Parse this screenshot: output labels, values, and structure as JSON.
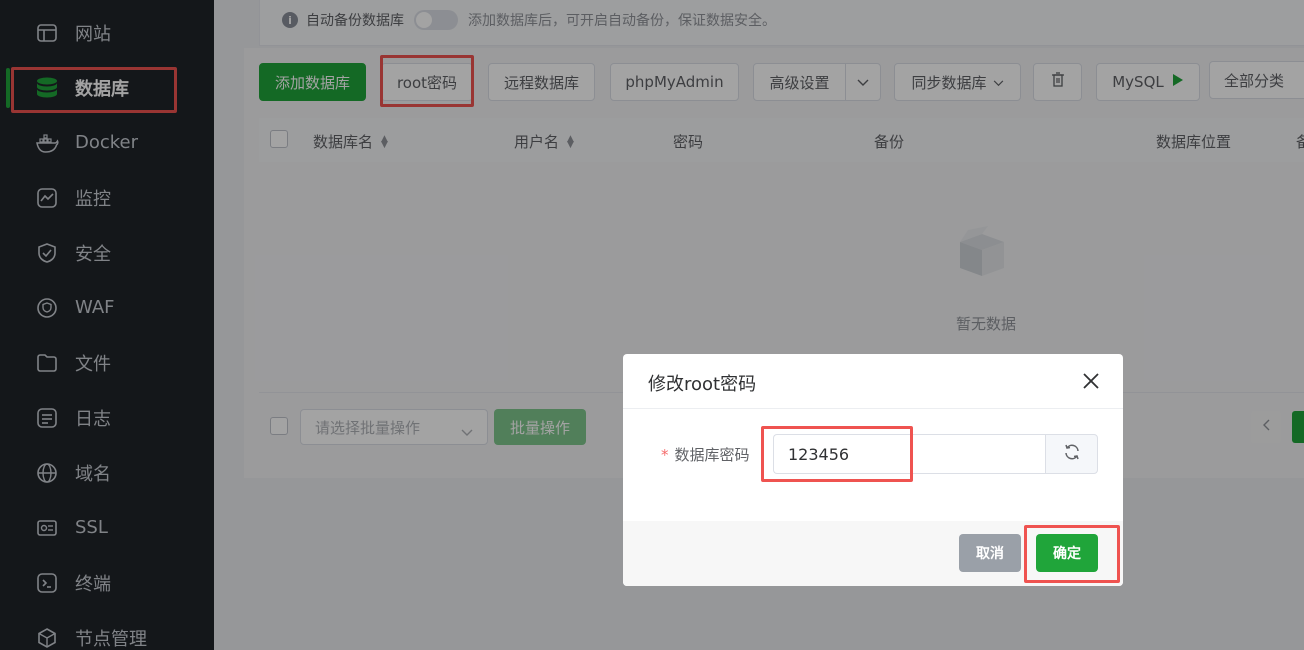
{
  "sidebar": {
    "items": [
      {
        "label": "网站",
        "icon": "website-icon"
      },
      {
        "label": "数据库",
        "icon": "database-icon",
        "active": true
      },
      {
        "label": "Docker",
        "icon": "docker-icon"
      },
      {
        "label": "监控",
        "icon": "monitor-icon"
      },
      {
        "label": "安全",
        "icon": "shield-icon"
      },
      {
        "label": "WAF",
        "icon": "waf-icon"
      },
      {
        "label": "文件",
        "icon": "folder-icon"
      },
      {
        "label": "日志",
        "icon": "log-icon"
      },
      {
        "label": "域名",
        "icon": "globe-icon"
      },
      {
        "label": "SSL",
        "icon": "ssl-icon"
      },
      {
        "label": "终端",
        "icon": "terminal-icon"
      },
      {
        "label": "节点管理",
        "icon": "node-icon"
      }
    ]
  },
  "tip": {
    "label": "自动备份数据库",
    "description": "添加数据库后，可开启自动备份，保证数据安全。"
  },
  "toolbar": {
    "add_db": "添加数据库",
    "root_pwd": "root密码",
    "remote_db": "远程数据库",
    "phpmyadmin": "phpMyAdmin",
    "advanced": "高级设置",
    "sync_db": "同步数据库",
    "mysql": "MySQL",
    "category": "全部分类"
  },
  "table": {
    "columns": [
      "数据库名",
      "用户名",
      "密码",
      "备份",
      "数据库位置",
      "备"
    ],
    "empty_text": "暂无数据"
  },
  "footer": {
    "batch_placeholder": "请选择批量操作",
    "batch_button": "批量操作"
  },
  "dialog": {
    "title": "修改root密码",
    "field_label": "数据库密码",
    "required_mark": "*",
    "password_value": "123456",
    "cancel": "取消",
    "confirm": "确定"
  },
  "colors": {
    "brand_green": "#20a53a",
    "sidebar_bg": "#20242a",
    "highlight_red": "#ef5350"
  }
}
